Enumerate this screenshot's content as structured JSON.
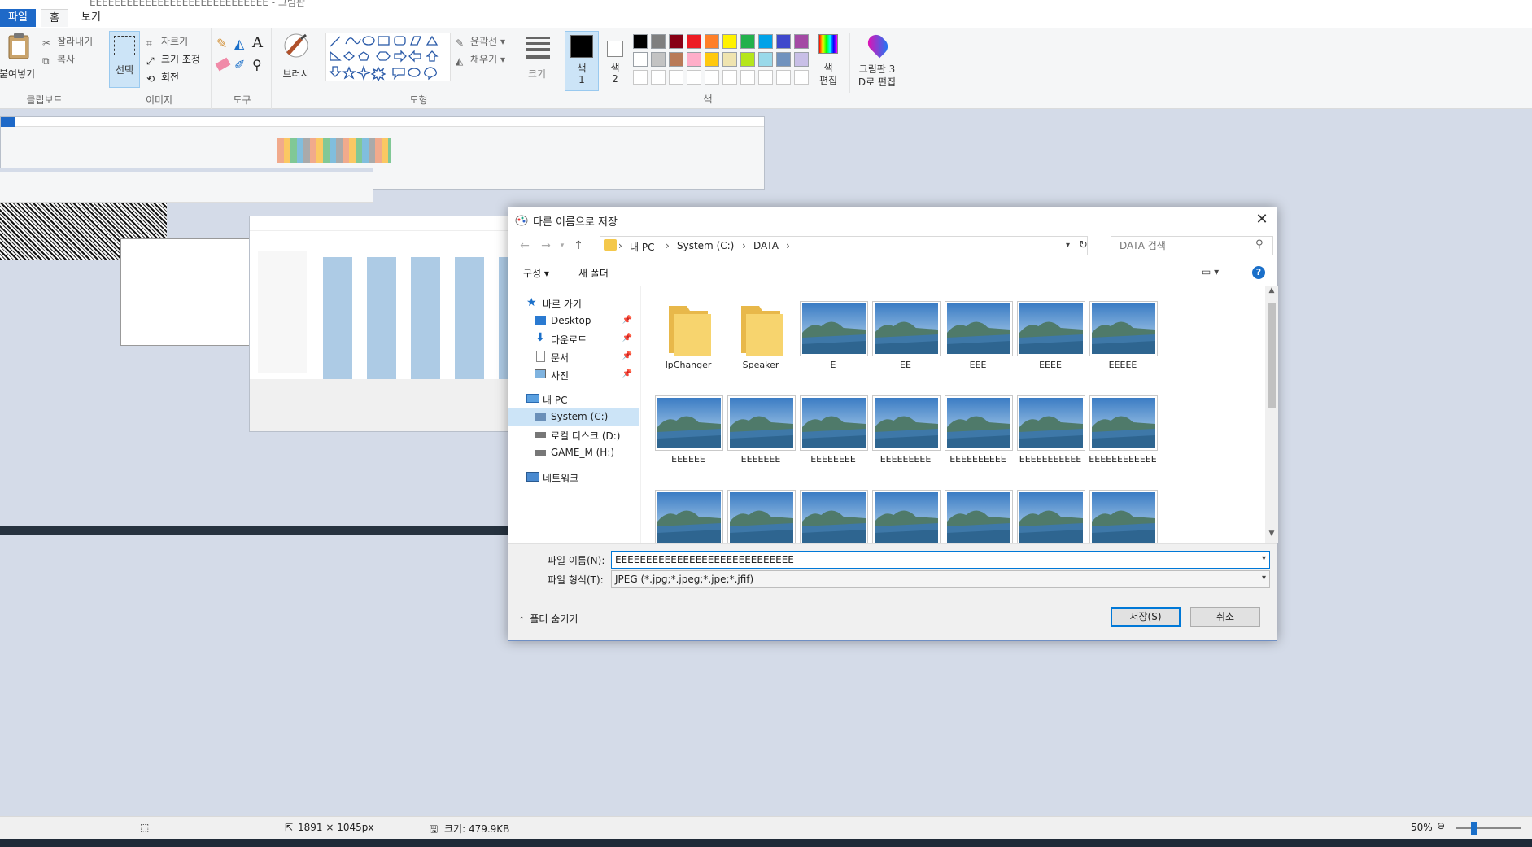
{
  "app": {
    "title": "EEEEEEEEEEEEEEEEEEEEEEEEEEEEE - 그림판",
    "tabs": [
      "파일",
      "홈",
      "보기"
    ]
  },
  "ribbon": {
    "clipboard": {
      "paste": "붙여넣기",
      "cut": "잘라내기",
      "copy": "복사",
      "label": "클립보드"
    },
    "image": {
      "select": "선택",
      "crop": "자르기",
      "resize": "크기 조정",
      "rotate": "회전",
      "label": "이미지"
    },
    "tools": {
      "label": "도구"
    },
    "brush": {
      "label": "브러시"
    },
    "shapes": {
      "outline": "윤곽선",
      "fill": "채우기",
      "label": "도형"
    },
    "size": {
      "label": "크기"
    },
    "colors": {
      "color1": "색\n1",
      "color1_a": "색",
      "color1_b": "1",
      "color2_a": "색",
      "color2_b": "2",
      "edit_a": "색",
      "edit_b": "편집",
      "label": "색",
      "palette": [
        "#000000",
        "#7f7f7f",
        "#880015",
        "#ed1c24",
        "#ff7f27",
        "#fff200",
        "#22b14c",
        "#00a2e8",
        "#3f48cc",
        "#a349a4",
        "#ffffff",
        "#c3c3c3",
        "#b97a57",
        "#ffaec9",
        "#ffc90e",
        "#efe4b0",
        "#b5e61d",
        "#99d9ea",
        "#7092be",
        "#c8bfe7"
      ]
    },
    "paint3d": {
      "line1": "그림판 3",
      "line2": "D로 편집"
    }
  },
  "dialog": {
    "title": "다른 이름으로 저장",
    "path": [
      "내 PC",
      "System (C:)",
      "DATA"
    ],
    "search_placeholder": "DATA 검색",
    "organize": "구성 ▾",
    "new_folder": "새 폴더",
    "nav": {
      "quick_access": "바로 가기",
      "desktop": "Desktop",
      "downloads": "다운로드",
      "documents": "문서",
      "pictures": "사진",
      "this_pc": "내 PC",
      "system_c": "System (C:)",
      "local_d": "로컬 디스크 (D:)",
      "game_h": "GAME_M (H:)",
      "network": "네트워크"
    },
    "folders": [
      "IpChanger",
      "Speaker"
    ],
    "files_row1": [
      "E",
      "EE",
      "EEE",
      "EEEE",
      "EEEEE"
    ],
    "files_row2": [
      "EEEEEE",
      "EEEEEEE",
      "EEEEEEEE",
      "EEEEEEEEE",
      "EEEEEEEEEE",
      "EEEEEEEEEEE",
      "EEEEEEEEEEEE"
    ],
    "filename_label": "파일 이름(N):",
    "filename_value": "EEEEEEEEEEEEEEEEEEEEEEEEEEEEE",
    "filetype_label": "파일 형식(T):",
    "filetype_value": "JPEG (*.jpg;*.jpeg;*.jpe;*.jfif)",
    "hide_folders": "폴더 숨기기",
    "save": "저장(S)",
    "cancel": "취소"
  },
  "status": {
    "dimensions": "1891 × 1045px",
    "size": "크기: 479.9KB",
    "zoom": "50%"
  }
}
